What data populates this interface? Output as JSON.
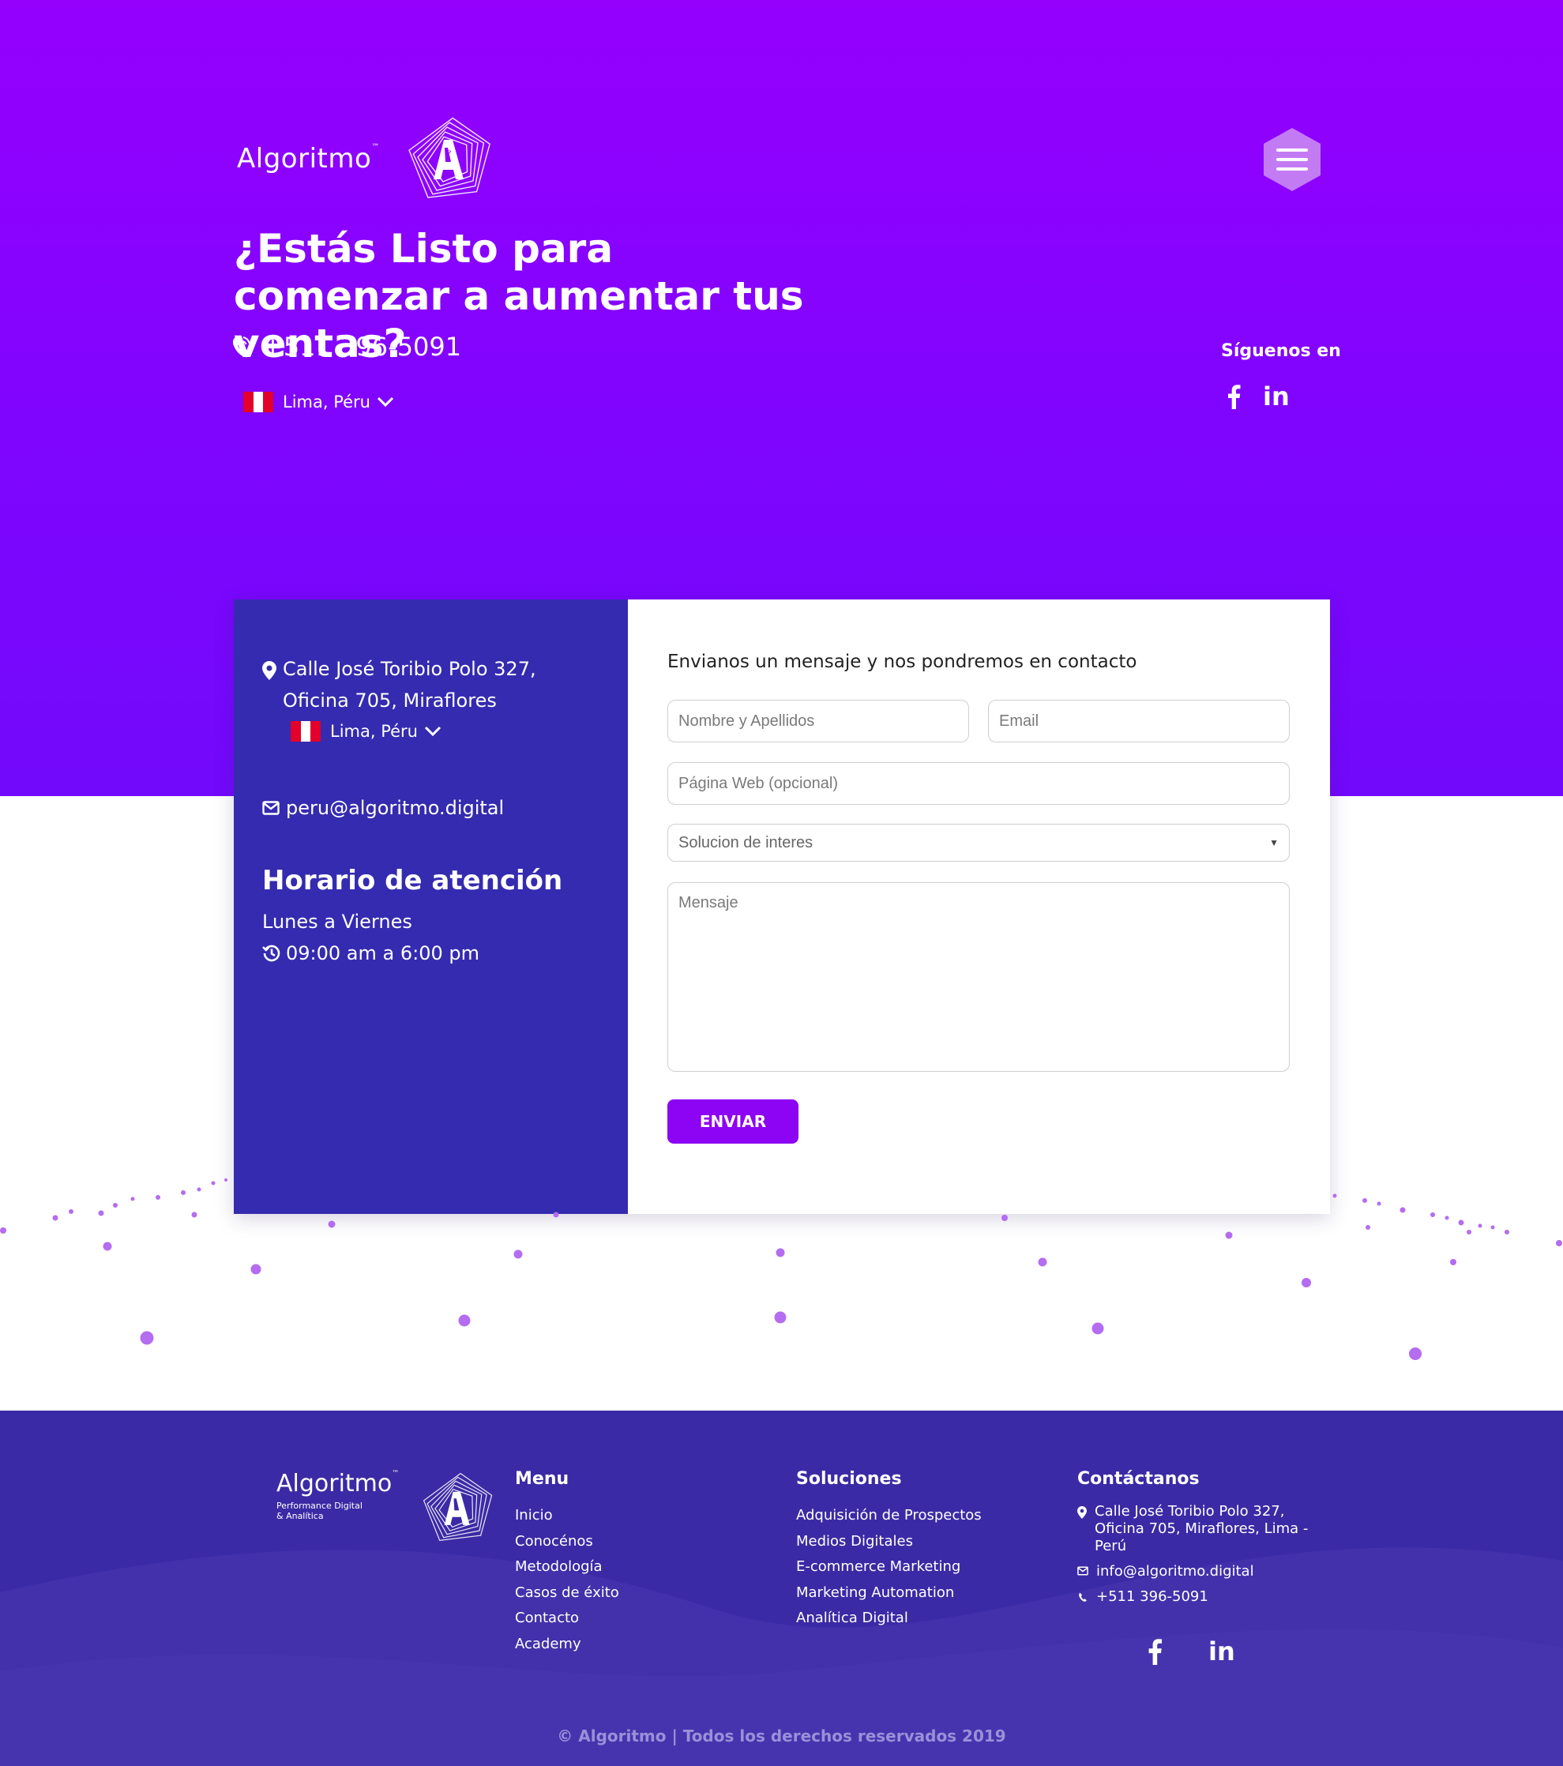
{
  "header": {
    "brand": "Algoritmo",
    "brand_tm": "™",
    "title": "¿Estás Listo para comenzar a aumentar tus ventas?",
    "phone": "+511 396-5091",
    "location": "Lima, Péru",
    "follow_label": "Síguenos en",
    "social": [
      "facebook-icon",
      "linkedin-icon"
    ],
    "linkedin_text": "in"
  },
  "contact_card": {
    "address_line1": "Calle José Toribio Polo 327,",
    "address_line2": "Oficina 705, Miraflores",
    "location": "Lima, Péru",
    "email": "peru@algoritmo.digital",
    "hours_title": "Horario de atención",
    "hours_days": "Lunes a Viernes",
    "hours_time": "09:00 am a 6:00 pm"
  },
  "form": {
    "title": "Envianos un mensaje y nos pondremos en contacto",
    "name_placeholder": "Nombre y Apellidos",
    "email_placeholder": "Email",
    "web_placeholder": "Página Web (opcional)",
    "solution_selected": "Solucion de interes",
    "message_placeholder": "Mensaje",
    "submit_label": "ENVIAR"
  },
  "footer": {
    "brand": "Algoritmo",
    "brand_tm": "™",
    "tagline1": "Performance Digital",
    "tagline2": "& Analítica",
    "menu_title": "Menu",
    "menu_items": [
      "Inicio",
      "Conocénos",
      "Metodología",
      "Casos de éxito",
      "Contacto",
      "Academy"
    ],
    "solutions_title": "Soluciones",
    "solutions_items": [
      "Adquisición de Prospectos",
      "Medios Digitales",
      "E-commerce Marketing",
      "Marketing Automation",
      "Analítica Digital"
    ],
    "contact_title": "Contáctanos",
    "contact_address": "Calle José Toribio Polo 327, Oficina 705, Miraflores, Lima - Perú",
    "contact_email": "info@algoritmo.digital",
    "contact_phone": "+511 396-5091",
    "linkedin_text": "in",
    "copyright": "© Algoritmo | Todos los derechos reservados 2019"
  },
  "colors": {
    "hero_top": "#9500fd",
    "hero_bottom": "#7209fa",
    "card_panel": "#352bb0",
    "button": "#8d03f3",
    "footer": "#3b2aa5",
    "particles": "#b46cf0"
  }
}
